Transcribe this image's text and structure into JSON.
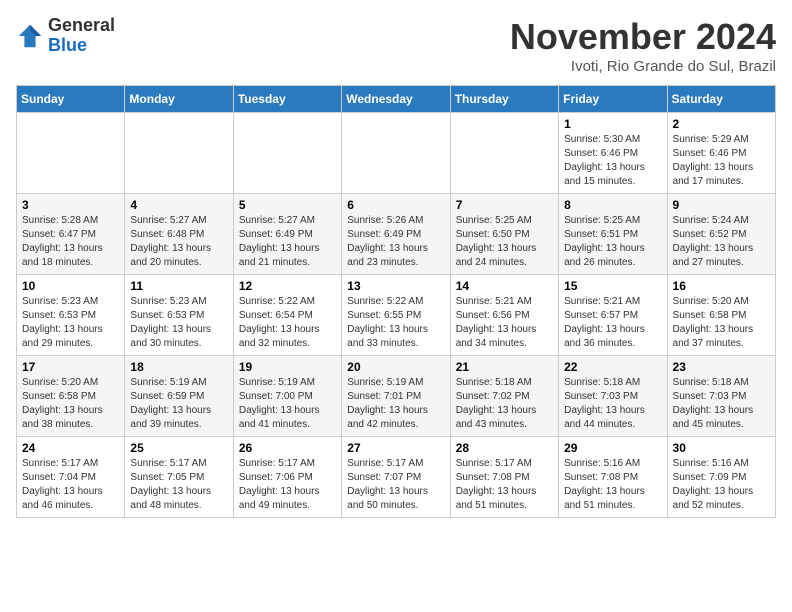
{
  "header": {
    "logo_line1": "General",
    "logo_line2": "Blue",
    "month_title": "November 2024",
    "location": "Ivoti, Rio Grande do Sul, Brazil"
  },
  "weekdays": [
    "Sunday",
    "Monday",
    "Tuesday",
    "Wednesday",
    "Thursday",
    "Friday",
    "Saturday"
  ],
  "weeks": [
    [
      {
        "day": "",
        "info": ""
      },
      {
        "day": "",
        "info": ""
      },
      {
        "day": "",
        "info": ""
      },
      {
        "day": "",
        "info": ""
      },
      {
        "day": "",
        "info": ""
      },
      {
        "day": "1",
        "info": "Sunrise: 5:30 AM\nSunset: 6:46 PM\nDaylight: 13 hours and 15 minutes."
      },
      {
        "day": "2",
        "info": "Sunrise: 5:29 AM\nSunset: 6:46 PM\nDaylight: 13 hours and 17 minutes."
      }
    ],
    [
      {
        "day": "3",
        "info": "Sunrise: 5:28 AM\nSunset: 6:47 PM\nDaylight: 13 hours and 18 minutes."
      },
      {
        "day": "4",
        "info": "Sunrise: 5:27 AM\nSunset: 6:48 PM\nDaylight: 13 hours and 20 minutes."
      },
      {
        "day": "5",
        "info": "Sunrise: 5:27 AM\nSunset: 6:49 PM\nDaylight: 13 hours and 21 minutes."
      },
      {
        "day": "6",
        "info": "Sunrise: 5:26 AM\nSunset: 6:49 PM\nDaylight: 13 hours and 23 minutes."
      },
      {
        "day": "7",
        "info": "Sunrise: 5:25 AM\nSunset: 6:50 PM\nDaylight: 13 hours and 24 minutes."
      },
      {
        "day": "8",
        "info": "Sunrise: 5:25 AM\nSunset: 6:51 PM\nDaylight: 13 hours and 26 minutes."
      },
      {
        "day": "9",
        "info": "Sunrise: 5:24 AM\nSunset: 6:52 PM\nDaylight: 13 hours and 27 minutes."
      }
    ],
    [
      {
        "day": "10",
        "info": "Sunrise: 5:23 AM\nSunset: 6:53 PM\nDaylight: 13 hours and 29 minutes."
      },
      {
        "day": "11",
        "info": "Sunrise: 5:23 AM\nSunset: 6:53 PM\nDaylight: 13 hours and 30 minutes."
      },
      {
        "day": "12",
        "info": "Sunrise: 5:22 AM\nSunset: 6:54 PM\nDaylight: 13 hours and 32 minutes."
      },
      {
        "day": "13",
        "info": "Sunrise: 5:22 AM\nSunset: 6:55 PM\nDaylight: 13 hours and 33 minutes."
      },
      {
        "day": "14",
        "info": "Sunrise: 5:21 AM\nSunset: 6:56 PM\nDaylight: 13 hours and 34 minutes."
      },
      {
        "day": "15",
        "info": "Sunrise: 5:21 AM\nSunset: 6:57 PM\nDaylight: 13 hours and 36 minutes."
      },
      {
        "day": "16",
        "info": "Sunrise: 5:20 AM\nSunset: 6:58 PM\nDaylight: 13 hours and 37 minutes."
      }
    ],
    [
      {
        "day": "17",
        "info": "Sunrise: 5:20 AM\nSunset: 6:58 PM\nDaylight: 13 hours and 38 minutes."
      },
      {
        "day": "18",
        "info": "Sunrise: 5:19 AM\nSunset: 6:59 PM\nDaylight: 13 hours and 39 minutes."
      },
      {
        "day": "19",
        "info": "Sunrise: 5:19 AM\nSunset: 7:00 PM\nDaylight: 13 hours and 41 minutes."
      },
      {
        "day": "20",
        "info": "Sunrise: 5:19 AM\nSunset: 7:01 PM\nDaylight: 13 hours and 42 minutes."
      },
      {
        "day": "21",
        "info": "Sunrise: 5:18 AM\nSunset: 7:02 PM\nDaylight: 13 hours and 43 minutes."
      },
      {
        "day": "22",
        "info": "Sunrise: 5:18 AM\nSunset: 7:03 PM\nDaylight: 13 hours and 44 minutes."
      },
      {
        "day": "23",
        "info": "Sunrise: 5:18 AM\nSunset: 7:03 PM\nDaylight: 13 hours and 45 minutes."
      }
    ],
    [
      {
        "day": "24",
        "info": "Sunrise: 5:17 AM\nSunset: 7:04 PM\nDaylight: 13 hours and 46 minutes."
      },
      {
        "day": "25",
        "info": "Sunrise: 5:17 AM\nSunset: 7:05 PM\nDaylight: 13 hours and 48 minutes."
      },
      {
        "day": "26",
        "info": "Sunrise: 5:17 AM\nSunset: 7:06 PM\nDaylight: 13 hours and 49 minutes."
      },
      {
        "day": "27",
        "info": "Sunrise: 5:17 AM\nSunset: 7:07 PM\nDaylight: 13 hours and 50 minutes."
      },
      {
        "day": "28",
        "info": "Sunrise: 5:17 AM\nSunset: 7:08 PM\nDaylight: 13 hours and 51 minutes."
      },
      {
        "day": "29",
        "info": "Sunrise: 5:16 AM\nSunset: 7:08 PM\nDaylight: 13 hours and 51 minutes."
      },
      {
        "day": "30",
        "info": "Sunrise: 5:16 AM\nSunset: 7:09 PM\nDaylight: 13 hours and 52 minutes."
      }
    ]
  ]
}
